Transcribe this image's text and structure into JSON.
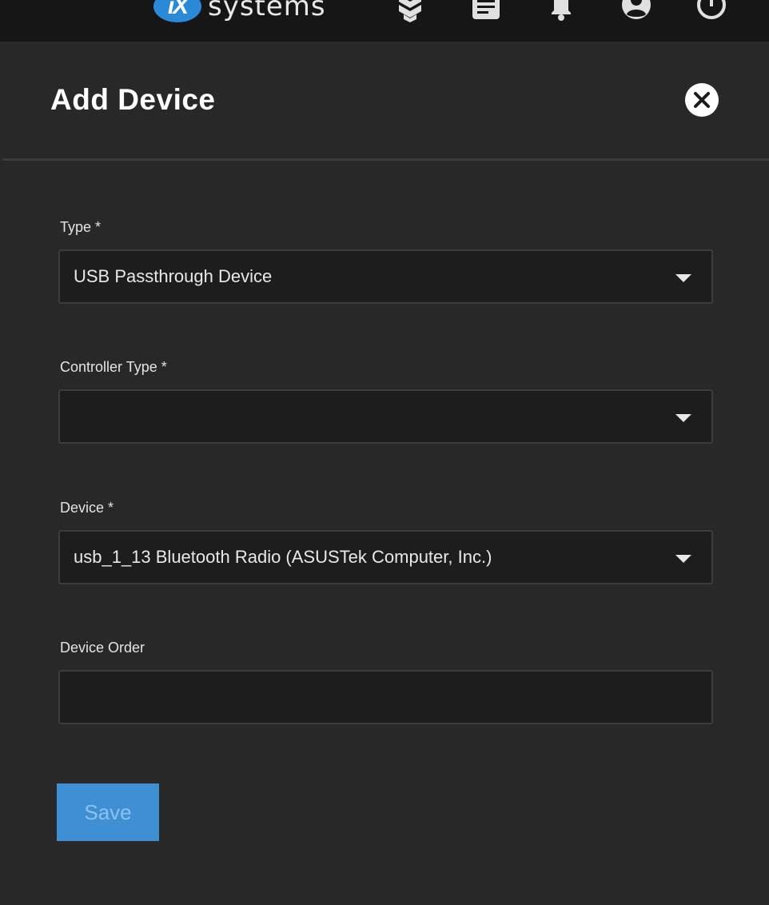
{
  "header": {
    "logo_badge": "iX",
    "logo_text": "systems",
    "icons": [
      "truecommand-icon",
      "tasks-icon",
      "notifications-icon",
      "account-icon",
      "power-icon"
    ]
  },
  "dialog": {
    "title": "Add Device",
    "fields": [
      {
        "label": "Type *",
        "value": "USB Passthrough Device",
        "kind": "select"
      },
      {
        "label": "Controller Type *",
        "value": "",
        "kind": "select"
      },
      {
        "label": "Device *",
        "value": "usb_1_13 Bluetooth Radio (ASUSTek Computer, Inc.)",
        "kind": "select"
      },
      {
        "label": "Device Order",
        "value": "",
        "kind": "input"
      }
    ],
    "save_label": "Save"
  },
  "colors": {
    "topbar": "#161616",
    "panel": "#282828",
    "field_bg": "#1d1d1d",
    "accent": "#3e8fd4"
  }
}
